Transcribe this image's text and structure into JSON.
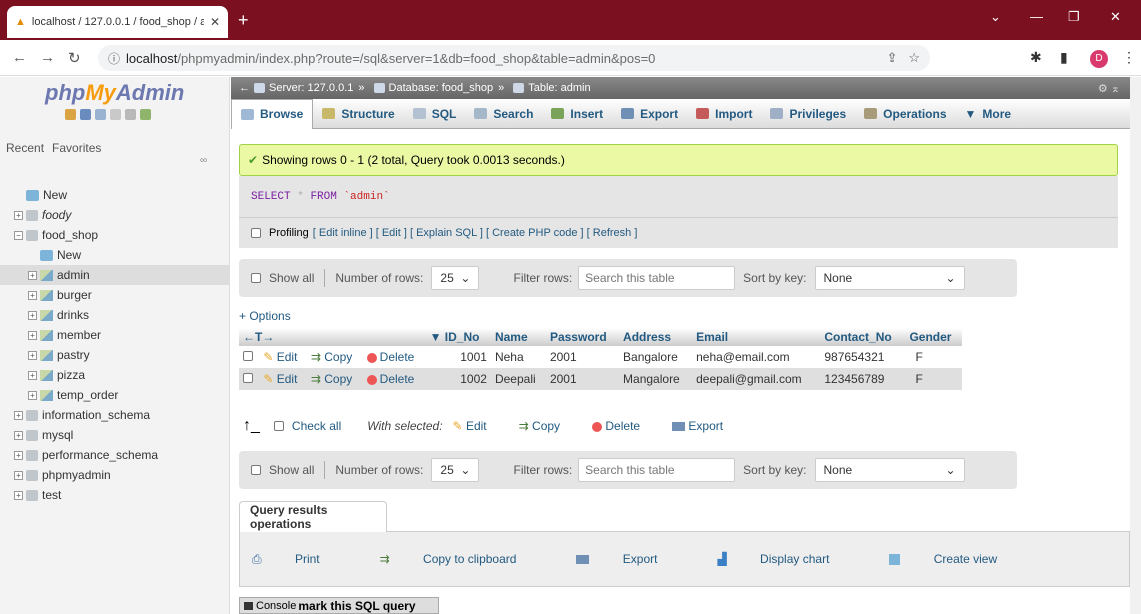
{
  "browser": {
    "tab_title": "localhost / 127.0.0.1 / food_shop / a",
    "address_host": "localhost",
    "address_rest": "/phpmyadmin/index.php?route=/sql&server=1&db=food_shop&table=admin&pos=0",
    "profile_initial": "D"
  },
  "sidebar": {
    "logo_php": "php",
    "logo_my": "My",
    "logo_admin": "Admin",
    "recent": "Recent",
    "favorites": "Favorites",
    "tree": [
      {
        "label": "New",
        "indent": 0
      },
      {
        "label": "foody",
        "indent": 0
      },
      {
        "label": "food_shop",
        "indent": 0
      },
      {
        "label": "New",
        "indent": 1
      },
      {
        "label": "admin",
        "indent": 1
      },
      {
        "label": "burger",
        "indent": 1
      },
      {
        "label": "drinks",
        "indent": 1
      },
      {
        "label": "member",
        "indent": 1
      },
      {
        "label": "pastry",
        "indent": 1
      },
      {
        "label": "pizza",
        "indent": 1
      },
      {
        "label": "temp_order",
        "indent": 1
      },
      {
        "label": "information_schema",
        "indent": 0
      },
      {
        "label": "mysql",
        "indent": 0
      },
      {
        "label": "performance_schema",
        "indent": 0
      },
      {
        "label": "phpmyadmin",
        "indent": 0
      },
      {
        "label": "test",
        "indent": 0
      }
    ]
  },
  "breadcrumb": {
    "server": "Server: 127.0.0.1",
    "database": "Database: food_shop",
    "table": "Table: admin"
  },
  "tabs": [
    "Browse",
    "Structure",
    "SQL",
    "Search",
    "Insert",
    "Export",
    "Import",
    "Privileges",
    "Operations",
    "More"
  ],
  "message": "Showing rows 0 - 1 (2 total, Query took 0.0013 seconds.)",
  "sql": {
    "select": "SELECT",
    "star": "*",
    "from": "FROM",
    "table": "`admin`"
  },
  "profiling": {
    "label": "Profiling",
    "links": "[ Edit inline ] [ Edit ] [ Explain SQL ] [ Create PHP code ] [ Refresh ]"
  },
  "controls": {
    "show_all": "Show all",
    "rows_label": "Number of rows:",
    "rows_value": "25",
    "filter_label": "Filter rows:",
    "filter_placeholder": "Search this table",
    "sort_label": "Sort by key:",
    "sort_value": "None"
  },
  "options_label": "+ Options",
  "table": {
    "columns": [
      "ID_No",
      "Name",
      "Password",
      "Address",
      "Email",
      "Contact_No",
      "Gender"
    ],
    "actions": {
      "edit": "Edit",
      "copy": "Copy",
      "delete": "Delete"
    },
    "rows": [
      [
        "1001",
        "Neha",
        "2001",
        "Bangalore",
        "neha@email.com",
        "987654321",
        "F"
      ],
      [
        "1002",
        "Deepali",
        "2001",
        "Mangalore",
        "deepali@gmail.com",
        "123456789",
        "F"
      ]
    ]
  },
  "bulk": {
    "check_all": "Check all",
    "with_selected": "With selected:",
    "edit": "Edit",
    "copy": "Copy",
    "delete": "Delete",
    "export": "Export"
  },
  "query_ops": {
    "title": "Query results operations",
    "print": "Print",
    "copy": "Copy to clipboard",
    "export": "Export",
    "chart": "Display chart",
    "view": "Create view"
  },
  "console": {
    "label": "Console",
    "bookmark": "mark this SQL query"
  }
}
